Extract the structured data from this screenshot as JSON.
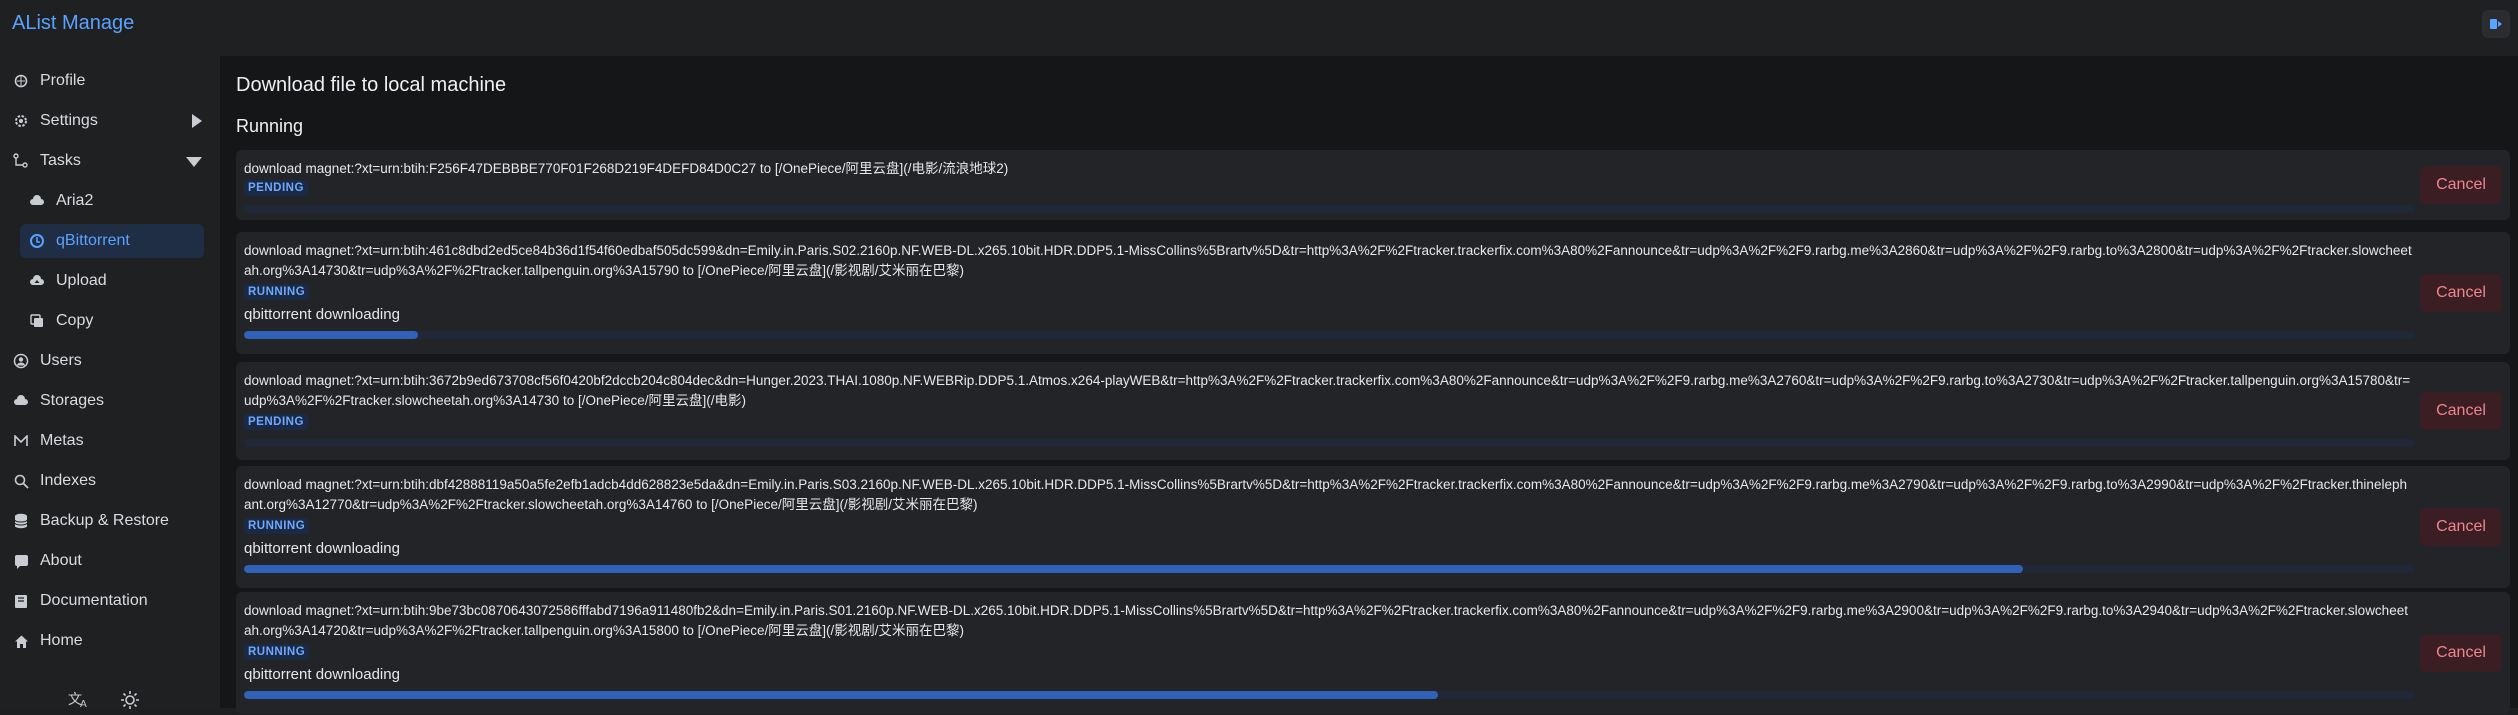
{
  "app": {
    "title": "AList Manage",
    "accent": "#5aa2ff"
  },
  "sidebar": {
    "items": [
      {
        "label": "Profile",
        "icon": "profile-icon"
      },
      {
        "label": "Settings",
        "icon": "gear-icon"
      },
      {
        "label": "Tasks",
        "icon": "tasks-icon"
      },
      {
        "label": "Aria2",
        "icon": "cloud-download-icon"
      },
      {
        "label": "qBittorrent",
        "icon": "qbittorrent-icon"
      },
      {
        "label": "Upload",
        "icon": "cloud-upload-icon"
      },
      {
        "label": "Copy",
        "icon": "copy-icon"
      },
      {
        "label": "Users",
        "icon": "users-icon"
      },
      {
        "label": "Storages",
        "icon": "storages-icon"
      },
      {
        "label": "Metas",
        "icon": "metas-icon"
      },
      {
        "label": "Indexes",
        "icon": "search-icon"
      },
      {
        "label": "Backup & Restore",
        "icon": "database-icon"
      },
      {
        "label": "About",
        "icon": "about-icon"
      },
      {
        "label": "Documentation",
        "icon": "book-icon"
      },
      {
        "label": "Home",
        "icon": "home-icon"
      }
    ],
    "active": "qBittorrent"
  },
  "main": {
    "title": "Download file to local machine",
    "section": "Running",
    "tasks": [
      {
        "name": "download magnet:?xt=urn:btih:F256F47DEBBBE770F01F268D219F4DEFD84D0C27 to [/OnePiece/阿里云盘](/电影/流浪地球2)",
        "state": "PENDING",
        "status": "",
        "progress": 0,
        "cancel": "Cancel"
      },
      {
        "name": "download magnet:?xt=urn:btih:461c8dbd2ed5ce84b36d1f54f60edbaf505dc599&dn=Emily.in.Paris.S02.2160p.NF.WEB-DL.x265.10bit.HDR.DDP5.1-MissCollins%5Brartv%5D&tr=http%3A%2F%2Ftracker.trackerfix.com%3A80%2Fannounce&tr=udp%3A%2F%2F9.rarbg.me%3A2860&tr=udp%3A%2F%2F9.rarbg.to%3A2800&tr=udp%3A%2F%2Ftracker.slowcheetah.org%3A14730&tr=udp%3A%2F%2Ftracker.tallpenguin.org%3A15790 to [/OnePiece/阿里云盘](/影视剧/艾米丽在巴黎)",
        "state": "RUNNING",
        "status": "qbittorrent downloading",
        "progress": 8,
        "cancel": "Cancel"
      },
      {
        "name": "download magnet:?xt=urn:btih:3672b9ed673708cf56f0420bf2dccb204c804dec&dn=Hunger.2023.THAI.1080p.NF.WEBRip.DDP5.1.Atmos.x264-playWEB&tr=http%3A%2F%2Ftracker.trackerfix.com%3A80%2Fannounce&tr=udp%3A%2F%2F9.rarbg.me%3A2760&tr=udp%3A%2F%2F9.rarbg.to%3A2730&tr=udp%3A%2F%2Ftracker.tallpenguin.org%3A15780&tr=udp%3A%2F%2Ftracker.slowcheetah.org%3A14730 to [/OnePiece/阿里云盘](/电影)",
        "state": "PENDING",
        "status": "",
        "progress": 0,
        "cancel": "Cancel"
      },
      {
        "name": "download magnet:?xt=urn:btih:dbf42888119a50a5fe2efb1adcb4dd628823e5da&dn=Emily.in.Paris.S03.2160p.NF.WEB-DL.x265.10bit.HDR.DDP5.1-MissCollins%5Brartv%5D&tr=http%3A%2F%2Ftracker.trackerfix.com%3A80%2Fannounce&tr=udp%3A%2F%2F9.rarbg.me%3A2790&tr=udp%3A%2F%2F9.rarbg.to%3A2990&tr=udp%3A%2F%2Ftracker.thinelephant.org%3A12770&tr=udp%3A%2F%2Ftracker.slowcheetah.org%3A14760 to [/OnePiece/阿里云盘](/影视剧/艾米丽在巴黎)",
        "state": "RUNNING",
        "status": "qbittorrent downloading",
        "progress": 82,
        "cancel": "Cancel"
      },
      {
        "name": "download magnet:?xt=urn:btih:9be73bc0870643072586fffabd7196a911480fb2&dn=Emily.in.Paris.S01.2160p.NF.WEB-DL.x265.10bit.HDR.DDP5.1-MissCollins%5Brartv%5D&tr=http%3A%2F%2Ftracker.trackerfix.com%3A80%2Fannounce&tr=udp%3A%2F%2F9.rarbg.me%3A2900&tr=udp%3A%2F%2F9.rarbg.to%3A2940&tr=udp%3A%2F%2Ftracker.slowcheetah.org%3A14720&tr=udp%3A%2F%2Ftracker.tallpenguin.org%3A15800 to [/OnePiece/阿里云盘](/影视剧/艾米丽在巴黎)",
        "state": "RUNNING",
        "status": "qbittorrent downloading",
        "progress": 55,
        "cancel": "Cancel"
      }
    ]
  },
  "footer": {
    "icons": [
      "language-icon",
      "theme-toggle-icon"
    ]
  },
  "colors": {
    "badge_bg": "#1a2a45",
    "badge_text": "#6ea8ff",
    "progress": "#2f62b8",
    "cancel_bg": "#3a1e24",
    "cancel_text": "#f1838d"
  }
}
